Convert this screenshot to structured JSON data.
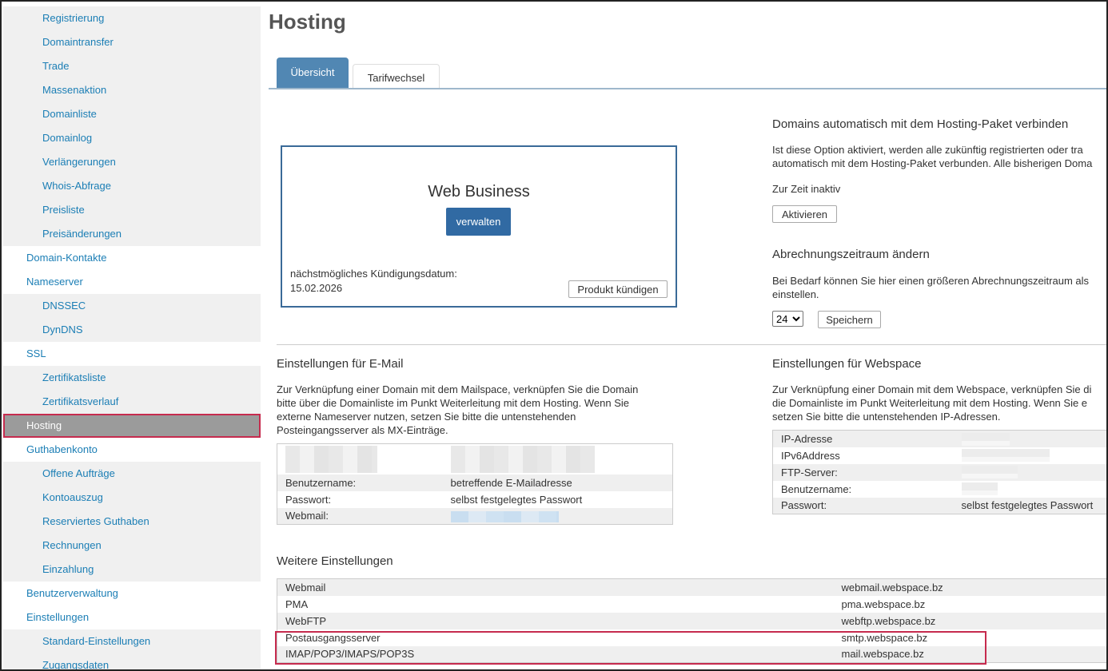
{
  "sidebar": {
    "items": [
      {
        "label": "Registrierung",
        "level": "sub"
      },
      {
        "label": "Domaintransfer",
        "level": "sub"
      },
      {
        "label": "Trade",
        "level": "sub"
      },
      {
        "label": "Massenaktion",
        "level": "sub"
      },
      {
        "label": "Domainliste",
        "level": "sub"
      },
      {
        "label": "Domainlog",
        "level": "sub"
      },
      {
        "label": "Verlängerungen",
        "level": "sub"
      },
      {
        "label": "Whois-Abfrage",
        "level": "sub"
      },
      {
        "label": "Preisliste",
        "level": "sub"
      },
      {
        "label": "Preisänderungen",
        "level": "sub"
      },
      {
        "label": "Domain-Kontakte",
        "level": "top"
      },
      {
        "label": "Nameserver",
        "level": "top"
      },
      {
        "label": "DNSSEC",
        "level": "sub"
      },
      {
        "label": "DynDNS",
        "level": "sub"
      },
      {
        "label": "SSL",
        "level": "top"
      },
      {
        "label": "Zertifikatsliste",
        "level": "sub"
      },
      {
        "label": "Zertifikatsverlauf",
        "level": "sub"
      },
      {
        "label": "Hosting",
        "level": "active"
      },
      {
        "label": "Guthabenkonto",
        "level": "top"
      },
      {
        "label": "Offene Aufträge",
        "level": "sub"
      },
      {
        "label": "Kontoauszug",
        "level": "sub"
      },
      {
        "label": "Reserviertes Guthaben",
        "level": "sub"
      },
      {
        "label": "Rechnungen",
        "level": "sub"
      },
      {
        "label": "Einzahlung",
        "level": "sub"
      },
      {
        "label": "Benutzerverwaltung",
        "level": "top"
      },
      {
        "label": "Einstellungen",
        "level": "top"
      },
      {
        "label": "Standard-Einstellungen",
        "level": "sub"
      },
      {
        "label": "Zugangsdaten",
        "level": "sub"
      }
    ]
  },
  "page": {
    "title": "Hosting"
  },
  "tabs": {
    "overview": "Übersicht",
    "tariff": "Tarifwechsel"
  },
  "product": {
    "name": "Web Business",
    "manage_button": "verwalten",
    "cancel_date_label": "nächstmögliches Kündigungsdatum:",
    "cancel_date": "15.02.2026",
    "cancel_button": "Produkt kündigen"
  },
  "auto_connect": {
    "title": "Domains automatisch mit dem Hosting-Paket verbinden",
    "text_line1": "Ist diese Option aktiviert, werden alle zukünftig registrierten oder tra",
    "text_line2": "automatisch mit dem Hosting-Paket verbunden. Alle bisherigen Doma",
    "status": "Zur Zeit inaktiv",
    "activate_button": "Aktivieren"
  },
  "billing": {
    "title": "Abrechnungszeitraum ändern",
    "text_line1": "Bei Bedarf können Sie hier einen größeren Abrechnungszeitraum als",
    "text_line2": "einstellen.",
    "selected_period": "24",
    "save_button": "Speichern"
  },
  "email": {
    "title": "Einstellungen für E-Mail",
    "text_lines": [
      "Zur Verknüpfung einer Domain mit dem Mailspace, verknüpfen Sie die Domain",
      "bitte über die Domainliste im Punkt Weiterleitung mit dem Hosting. Wenn Sie",
      "externe Nameserver nutzen, setzen Sie bitte die untenstehenden",
      "Posteingangsserver als MX-Einträge."
    ],
    "rows": [
      {
        "label": "",
        "value": ""
      },
      {
        "label": "Benutzername:",
        "value": "betreffende E-Mailadresse"
      },
      {
        "label": "Passwort:",
        "value": "selbst festgelegtes Passwort"
      },
      {
        "label": "Webmail:",
        "value": ""
      }
    ]
  },
  "webspace": {
    "title": "Einstellungen für Webspace",
    "text_lines": [
      "Zur Verknüpfung einer Domain mit dem Webspace, verknüpfen Sie di",
      "die Domainliste im Punkt Weiterleitung mit dem Hosting. Wenn Sie e",
      "setzen Sie bitte die untenstehenden IP-Adressen."
    ],
    "rows": [
      {
        "label": "IP-Adresse",
        "value": ""
      },
      {
        "label": "IPv6Address",
        "value": ""
      },
      {
        "label": "FTP-Server:",
        "value": ""
      },
      {
        "label": "Benutzername:",
        "value": ""
      },
      {
        "label": "Passwort:",
        "value": "selbst festgelegtes Passwort"
      }
    ]
  },
  "more": {
    "title": "Weitere Einstellungen",
    "rows": [
      {
        "label": "Webmail",
        "value": "webmail.webspace.bz"
      },
      {
        "label": "PMA",
        "value": "pma.webspace.bz"
      },
      {
        "label": "WebFTP",
        "value": "webftp.webspace.bz"
      },
      {
        "label": "Postausgangsserver",
        "value": "smtp.webspace.bz"
      },
      {
        "label": "IMAP/POP3/IMAPS/POP3S",
        "value": "mail.webspace.bz"
      }
    ]
  },
  "colors": {
    "link": "#1b7eb5",
    "active_tab": "#5187b3",
    "primary_button": "#316aa3",
    "highlight": "#c62b4e",
    "sidebar_active": "#9b9b9b"
  }
}
